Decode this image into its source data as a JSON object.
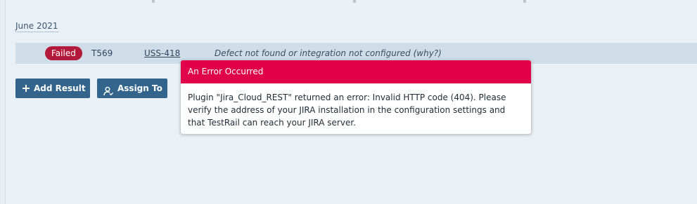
{
  "results": {
    "date_group": "June 2021",
    "row": {
      "status": "Failed",
      "test_id": "T569",
      "defect_id": "USS-418",
      "defect_message": "Defect not found or integration not configured",
      "why_link": "(why?)"
    }
  },
  "actions": {
    "add_result_label": "Add Result",
    "assign_to_label": "Assign To",
    "add_icon": "plus-icon",
    "assign_icon": "user-assign-icon"
  },
  "error_popup": {
    "title": "An Error Occurred",
    "lines": [
      "Plugin \"Jira_Cloud_REST\" returned an error: Invalid HTTP code (404). Please",
      "verify the address of your JIRA installation in the configuration settings and",
      "that TestRail can reach your JIRA server."
    ]
  },
  "colors": {
    "failed_badge": "#b2193b",
    "error_header": "#e1004a",
    "button": "#33648c",
    "panel_bg": "#e9f0f6",
    "row_bg": "#cfdde8"
  }
}
